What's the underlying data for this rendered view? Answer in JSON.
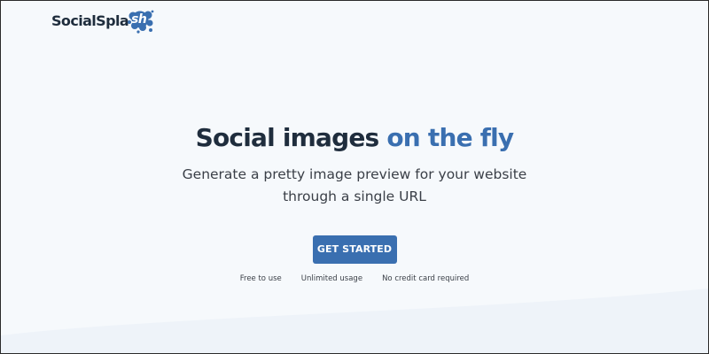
{
  "brand": {
    "name_main": "SocialSpla",
    "name_splash": "sh",
    "splash_color": "#3a6fb0"
  },
  "hero": {
    "headline_main": "Social images",
    "headline_accent": "on the fly",
    "subtitle": "Generate a pretty image preview for your website through a single URL"
  },
  "cta": {
    "label": "GET STARTED"
  },
  "features": [
    "Free to use",
    "Unlimited usage",
    "No credit card required"
  ],
  "colors": {
    "background": "#f6f9fc",
    "text_dark": "#1f2d3d",
    "accent": "#3a6fb0",
    "button_text": "#ffffff"
  }
}
